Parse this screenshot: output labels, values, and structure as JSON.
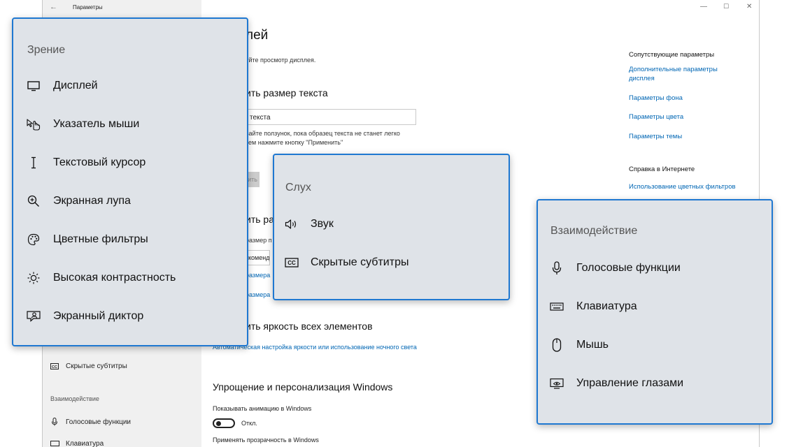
{
  "window": {
    "title": "Параметры",
    "back_icon": "←",
    "min_icon": "—",
    "max_icon": "☐",
    "close_icon": "✕"
  },
  "sidebar": {
    "cc_label": "Скрытые субтитры",
    "interaction_heading": "Взаимодействие",
    "voice_label": "Голосовые функции",
    "keyboard_label": "Клавиатура"
  },
  "main": {
    "title": "лей",
    "subtitle": "уйте просмотр дисплея.",
    "text_size_heading": "ить размер текста",
    "sample_text": "текста",
    "slider_hint": "вайте ползунок, пока образец текста не станет легко\nтем нажмите кнопку \"Применить\"",
    "apply_label": "ить",
    "scale_heading": "ить ра",
    "scale_label": "размер п",
    "scale_value": "коменду",
    "scale_link_1": "размера",
    "scale_link_2": "размера",
    "brightness_heading": "ить яркость всех элементов",
    "brightness_link": "Автоматическая настройка яркости или использование ночного света",
    "simplify_heading": "Упрощение и персонализация Windows",
    "animation_label": "Показывать анимацию в Windows",
    "animation_state": "Откл.",
    "transparency_label": "Применять прозрачность в Windows"
  },
  "related": {
    "heading": "Сопутствующие параметры",
    "links": [
      "Дополнительные параметры дисплея",
      "Параметры фона",
      "Параметры цвета",
      "Параметры темы"
    ],
    "help_heading": "Справка в Интернете",
    "help_links": [
      "Использование цветных фильтров"
    ]
  },
  "vision_card": {
    "title": "Зрение",
    "items": [
      {
        "label": "Дисплей",
        "icon": "monitor-icon"
      },
      {
        "label": "Указатель мыши",
        "icon": "pointer-hand-icon"
      },
      {
        "label": "Текстовый курсор",
        "icon": "text-cursor-icon"
      },
      {
        "label": "Экранная лупа",
        "icon": "magnifier-icon"
      },
      {
        "label": "Цветные фильтры",
        "icon": "palette-icon"
      },
      {
        "label": "Высокая контрастность",
        "icon": "contrast-sun-icon"
      },
      {
        "label": "Экранный диктор",
        "icon": "narrator-icon"
      }
    ]
  },
  "hearing_card": {
    "title": "Слух",
    "items": [
      {
        "label": "Звук",
        "icon": "speaker-icon"
      },
      {
        "label": "Скрытые субтитры",
        "icon": "closed-captions-icon"
      }
    ]
  },
  "interaction_card": {
    "title": "Взаимодействие",
    "items": [
      {
        "label": "Голосовые функции",
        "icon": "microphone-icon"
      },
      {
        "label": "Клавиатура",
        "icon": "keyboard-icon"
      },
      {
        "label": "Мышь",
        "icon": "mouse-icon"
      },
      {
        "label": "Управление глазами",
        "icon": "eye-control-icon"
      }
    ]
  },
  "colors": {
    "card_bg": "#dfe3e8",
    "card_border": "#1f78d1",
    "link": "#0066b4",
    "sidebar_bg": "#f0f0f0"
  }
}
